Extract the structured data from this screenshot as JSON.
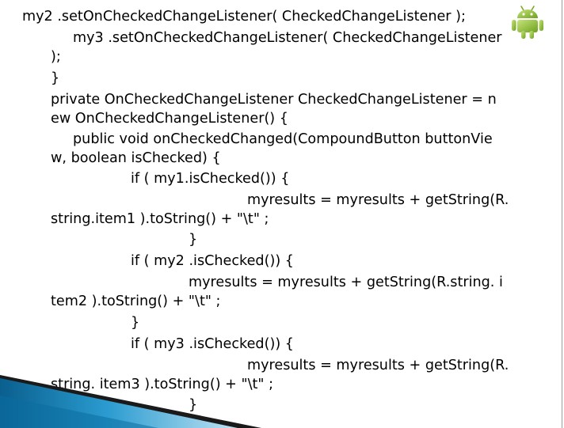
{
  "slide": {
    "lines": [
      "my2 .setOnCheckedChangeListener( CheckedChangeListener );",
      "my3 .setOnCheckedChangeListener( CheckedChangeListener",
      ");",
      "}",
      "private OnCheckedChangeListener CheckedChangeListener = n",
      "ew OnCheckedChangeListener() {",
      "public void onCheckedChanged(CompoundButton buttonVie",
      "w, boolean isChecked) {",
      "if ( my1.isChecked()) {",
      "myresults = myresults + getString(R.",
      "string.item1 ).toString() + \"\\t\" ;",
      "}",
      "if ( my2 .isChecked()) {",
      "myresults = myresults + getString(R.string. i",
      "tem2 ).toString() + \"\\t\" ;",
      "}",
      "if ( my3 .isChecked()) {",
      "myresults = myresults + getString(R.",
      "string. item3 ).toString() + \"\\t\" ;",
      "}"
    ]
  },
  "logo": {
    "icon": "android-robot-icon",
    "color": "#8ebf2f"
  },
  "decoration": {
    "accent": "#1d8fbf",
    "dark": "#1a1a1a"
  }
}
